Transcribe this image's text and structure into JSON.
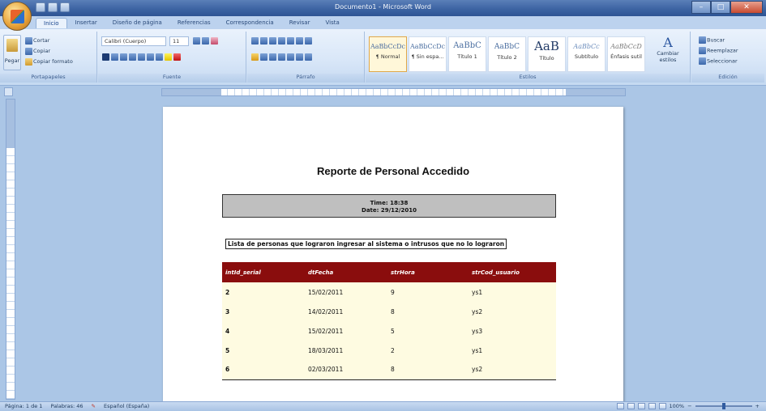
{
  "window": {
    "title": "Documento1 - Microsoft Word",
    "buttons": [
      "–",
      "□",
      "✕"
    ]
  },
  "tabs": [
    "Inicio",
    "Insertar",
    "Diseño de página",
    "Referencias",
    "Correspondencia",
    "Revisar",
    "Vista"
  ],
  "ribbon": {
    "clipboard": {
      "label": "Portapapeles",
      "paste": "Pegar",
      "cut": "Cortar",
      "copy": "Copiar",
      "format_painter": "Copiar formato"
    },
    "font": {
      "label": "Fuente",
      "font_name": "Calibri (Cuerpo)",
      "font_size": "11"
    },
    "paragraph": {
      "label": "Párrafo"
    },
    "styles": {
      "label": "Estilos",
      "items": [
        {
          "sample": "AaBbCcDc",
          "name": "¶ Normal"
        },
        {
          "sample": "AaBbCcDc",
          "name": "¶ Sin espa..."
        },
        {
          "sample": "AaBbC",
          "name": "Título 1"
        },
        {
          "sample": "AaBbC",
          "name": "Título 2"
        },
        {
          "sample": "AaB",
          "name": "Título"
        },
        {
          "sample": "AaBbCc",
          "name": "Subtítulo"
        },
        {
          "sample": "AaBbCcD",
          "name": "Énfasis sutil"
        }
      ],
      "change_styles": "Cambiar estilos"
    },
    "editing": {
      "label": "Edición",
      "find": "Buscar",
      "replace": "Reemplazar",
      "select": "Seleccionar"
    }
  },
  "document": {
    "title": "Reporte  de Personal Accedido",
    "time_line": "Time: 18:38",
    "date_line": "Date: 29/12/2010",
    "intro": "Lista de personas que lograron ingresar al sistema o intrusos que no lo lograron",
    "table": {
      "headers": [
        "intId_serial",
        "dtFecha",
        "strHora",
        "strCod_usuario"
      ],
      "rows": [
        [
          "2",
          "15/02/2011",
          "9",
          "ys1"
        ],
        [
          "3",
          "14/02/2011",
          "8",
          "ys2"
        ],
        [
          "4",
          "15/02/2011",
          "5",
          "ys3"
        ],
        [
          "5",
          "18/03/2011",
          "2",
          "ys1"
        ],
        [
          "6",
          "02/03/2011",
          "8",
          "ys2"
        ]
      ]
    }
  },
  "statusbar": {
    "page": "Página: 1 de 1",
    "words": "Palabras: 46",
    "language": "Español (España)",
    "zoom": "100%"
  }
}
